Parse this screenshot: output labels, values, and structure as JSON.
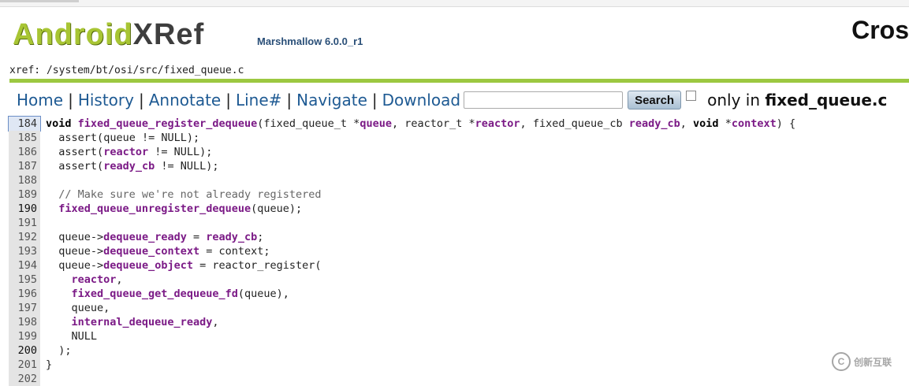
{
  "header": {
    "logo_part1": "Android",
    "logo_part2": "XRef",
    "version": "Marshmallow 6.0.0_r1",
    "title_partial": "Cros"
  },
  "breadcrumb": "xref: /system/bt/osi/src/fixed_queue.c",
  "nav": {
    "home": "Home",
    "history": "History",
    "annotate": "Annotate",
    "line": "Line#",
    "navigate": "Navigate",
    "download": "Download",
    "search_value": "",
    "search_button": "Search",
    "only_in_prefix": "only in",
    "only_in_file": "fixed_queue.c"
  },
  "code_lines": [
    {
      "num": "184",
      "text": "void fixed_queue_register_dequeue(fixed_queue_t *queue, reactor_t *reactor, fixed_queue_cb ready_cb, void *context) {"
    },
    {
      "num": "185",
      "text": "  assert(queue != NULL);"
    },
    {
      "num": "186",
      "text": "  assert(reactor != NULL);"
    },
    {
      "num": "187",
      "text": "  assert(ready_cb != NULL);"
    },
    {
      "num": "188",
      "text": ""
    },
    {
      "num": "189",
      "text": "  // Make sure we're not already registered"
    },
    {
      "num": "190",
      "text": "  fixed_queue_unregister_dequeue(queue);"
    },
    {
      "num": "191",
      "text": ""
    },
    {
      "num": "192",
      "text": "  queue->dequeue_ready = ready_cb;"
    },
    {
      "num": "193",
      "text": "  queue->dequeue_context = context;"
    },
    {
      "num": "194",
      "text": "  queue->dequeue_object = reactor_register("
    },
    {
      "num": "195",
      "text": "    reactor,"
    },
    {
      "num": "196",
      "text": "    fixed_queue_get_dequeue_fd(queue),"
    },
    {
      "num": "197",
      "text": "    queue,"
    },
    {
      "num": "198",
      "text": "    internal_dequeue_ready,"
    },
    {
      "num": "199",
      "text": "    NULL"
    },
    {
      "num": "200",
      "text": "  );"
    },
    {
      "num": "201",
      "text": "}"
    },
    {
      "num": "202",
      "text": ""
    }
  ],
  "watermark_text": "创新互联",
  "watermark_glyph": "C"
}
